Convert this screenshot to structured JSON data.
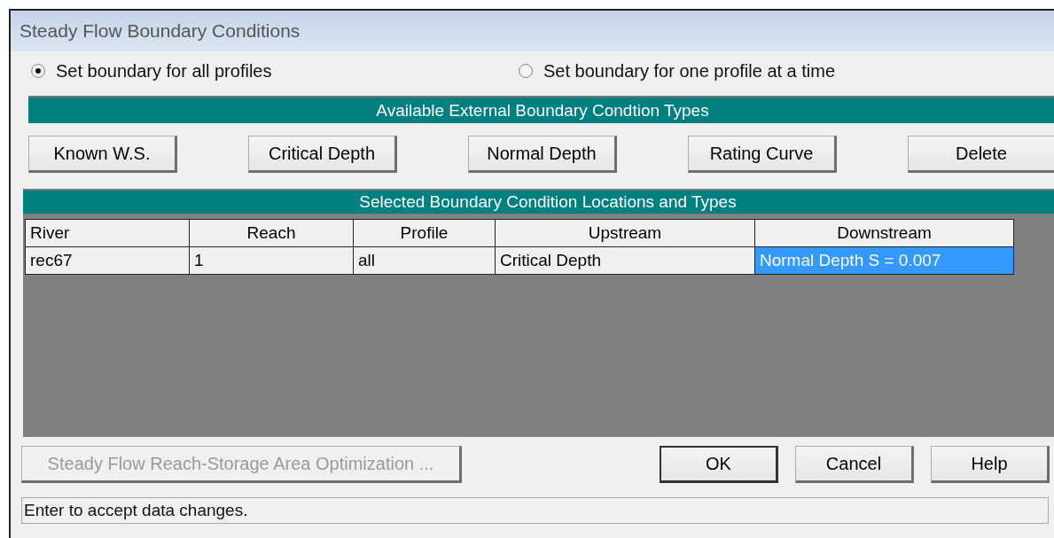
{
  "window": {
    "title": "Steady Flow Boundary Conditions"
  },
  "boundary_mode": [
    {
      "label": "Set boundary for all profiles",
      "selected": true
    },
    {
      "label": "Set boundary for one profile at a time",
      "selected": false
    }
  ],
  "available_types": {
    "header": "Available External Boundary Condtion Types",
    "buttons": [
      "Known W.S.",
      "Critical Depth",
      "Normal Depth",
      "Rating Curve",
      "Delete"
    ]
  },
  "selected_locations": {
    "header": "Selected Boundary Condition Locations and Types",
    "columns": [
      "River",
      "Reach",
      "Profile",
      "Upstream",
      "Downstream"
    ],
    "rows": [
      {
        "cells": [
          {
            "text": "rec67",
            "selected": false
          },
          {
            "text": "1",
            "selected": false
          },
          {
            "text": "all",
            "selected": false
          },
          {
            "text": "Critical Depth",
            "selected": false
          },
          {
            "text": "Normal Depth S = 0.007",
            "selected": true
          }
        ]
      }
    ]
  },
  "actions": [
    {
      "label": "Steady Flow Reach-Storage Area Optimization ...",
      "disabled": true,
      "default": false
    },
    {
      "label": "OK",
      "disabled": false,
      "default": true
    },
    {
      "label": "Cancel",
      "disabled": false,
      "default": false
    },
    {
      "label": "Help",
      "disabled": false,
      "default": false
    }
  ],
  "status_bar": "Enter to accept data changes."
}
